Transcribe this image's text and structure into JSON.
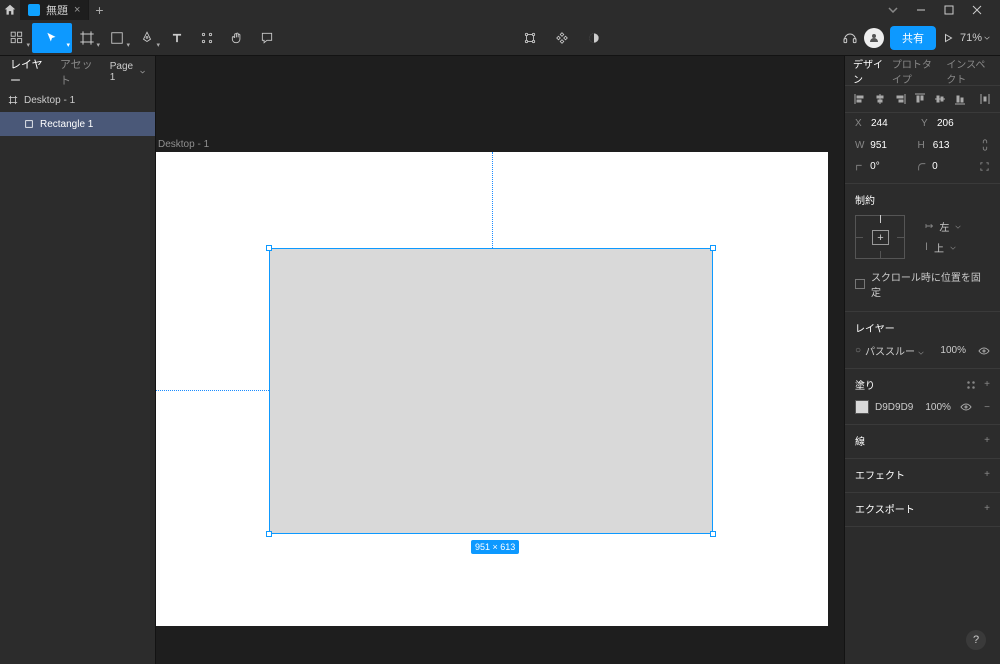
{
  "titlebar": {
    "tab_name": "無題",
    "newtab": "+"
  },
  "toolbar": {
    "share": "共有",
    "zoom": "71%"
  },
  "left": {
    "tab_layers": "レイヤー",
    "tab_assets": "アセット",
    "page": "Page 1",
    "frame": "Desktop - 1",
    "layer": "Rectangle 1"
  },
  "canvas": {
    "frame_label": "Desktop - 1",
    "dim_label": "951 × 613"
  },
  "right": {
    "tab_design": "デザイン",
    "tab_proto": "プロトタイプ",
    "tab_inspect": "インスペクト",
    "x_lbl": "X",
    "x_val": "244",
    "y_lbl": "Y",
    "y_val": "206",
    "w_lbl": "W",
    "w_val": "951",
    "h_lbl": "H",
    "h_val": "613",
    "rot_val": "0°",
    "rad_val": "0",
    "constraints_head": "制約",
    "c_left": "左",
    "c_top": "上",
    "scroll_fix": "スクロール時に位置を固定",
    "layer_head": "レイヤー",
    "passthrough": "パススルー",
    "layer_opacity": "100%",
    "fill_head": "塗り",
    "fill_hex": "D9D9D9",
    "fill_opacity": "100%",
    "stroke_head": "線",
    "effect_head": "エフェクト",
    "export_head": "エクスポート"
  }
}
